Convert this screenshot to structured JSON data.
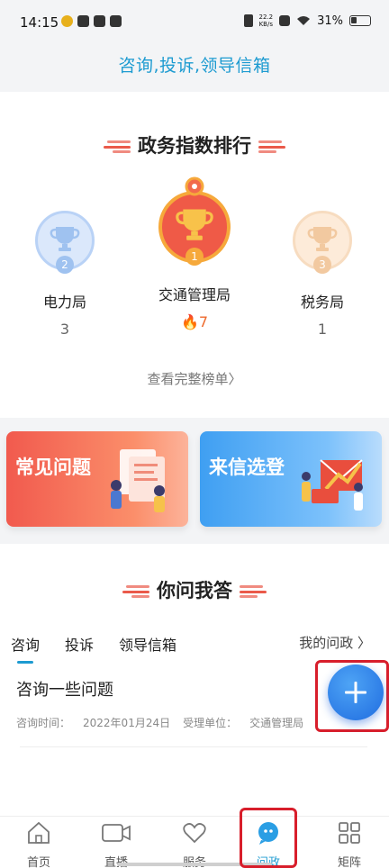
{
  "status_bar": {
    "time": "14:15",
    "net_speed": "22.2",
    "net_unit": "KB/s",
    "battery": "31%"
  },
  "header": {
    "title": "咨询,投诉,领导信箱"
  },
  "ranking": {
    "title": "政务指数排行",
    "items": [
      {
        "rank": "2",
        "name": "电力局",
        "score": "3"
      },
      {
        "rank": "1",
        "name": "交通管理局",
        "score": "7"
      },
      {
        "rank": "3",
        "name": "税务局",
        "score": "1"
      }
    ],
    "view_all": "查看完整榜单"
  },
  "banners": [
    {
      "label": "常见问题"
    },
    {
      "label": "来信选登"
    }
  ],
  "qa": {
    "title": "你问我答",
    "tabs": [
      "咨询",
      "投诉",
      "领导信箱"
    ],
    "my_link": "我的问政",
    "question": {
      "title": "咨询一些问题",
      "time_label": "咨询时间：",
      "time": "2022年01月24日",
      "unit_label": "受理单位：",
      "unit": "交通管理局"
    }
  },
  "tabbar": {
    "items": [
      {
        "label": "首页",
        "icon": "home-icon"
      },
      {
        "label": "直播",
        "icon": "video-icon"
      },
      {
        "label": "服务",
        "icon": "heart-icon"
      },
      {
        "label": "问政",
        "icon": "chat-icon"
      },
      {
        "label": "矩阵",
        "icon": "grid-icon"
      }
    ],
    "active_index": 3
  },
  "colors": {
    "accent": "#1d9bd1",
    "highlight": "#d81e2b",
    "hot": "#ee6a2d"
  }
}
